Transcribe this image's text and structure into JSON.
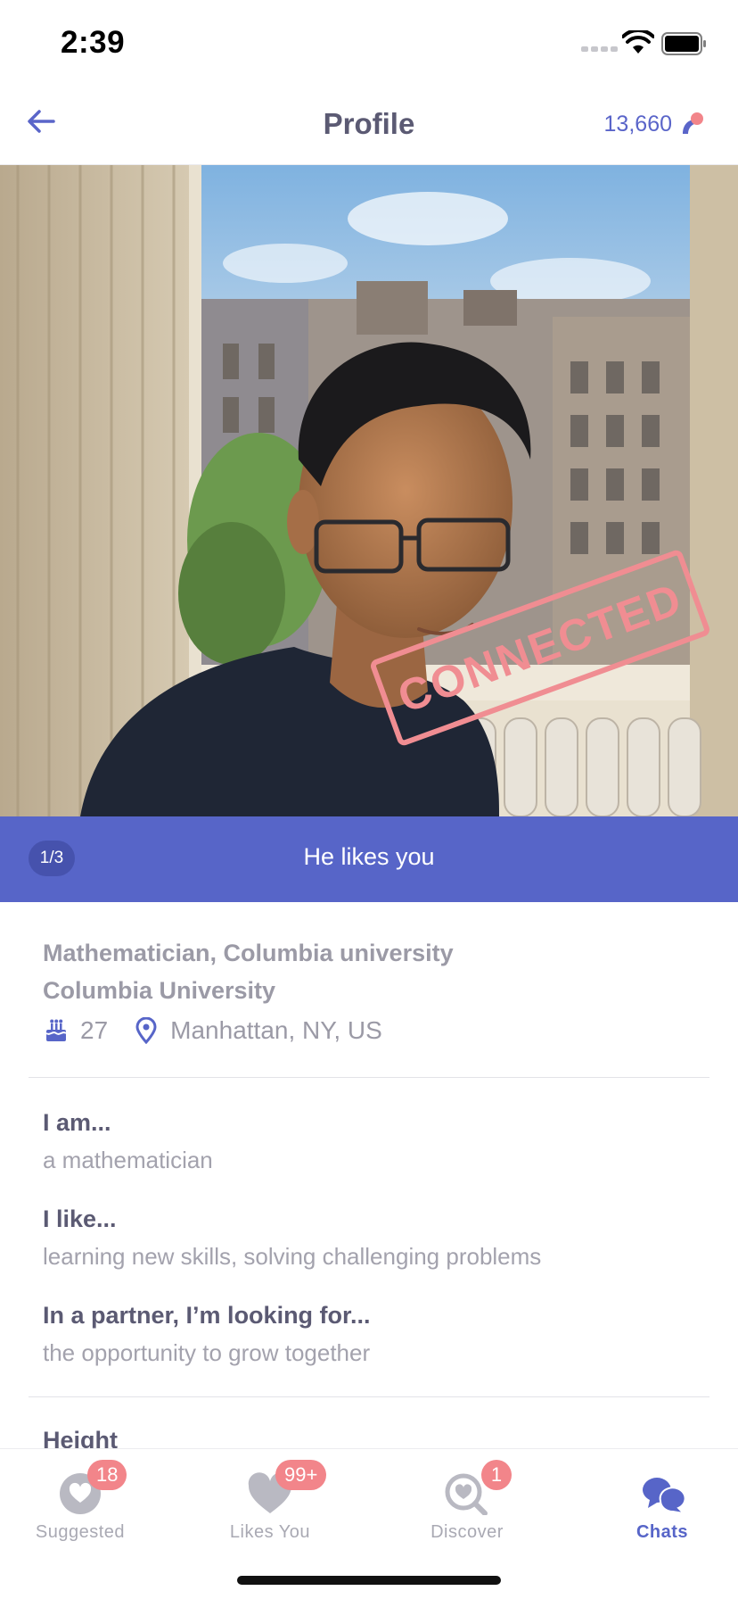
{
  "status_bar": {
    "time": "2:39"
  },
  "nav": {
    "title": "Profile",
    "coins": "13,660"
  },
  "photo": {
    "stamp_text": "CONNECTED"
  },
  "banner": {
    "page_indicator": "1/3",
    "likes_text": "He likes you"
  },
  "profile": {
    "job": "Mathematician, Columbia university",
    "school": "Columbia University",
    "age": "27",
    "location": "Manhattan, NY, US"
  },
  "prompts": [
    {
      "label": "I am...",
      "answer": "a mathematician"
    },
    {
      "label": "I like...",
      "answer": "learning new skills, solving challenging problems"
    },
    {
      "label": "In a partner, I’m looking for...",
      "answer": "the opportunity to grow together"
    }
  ],
  "next_section": "Height",
  "tabs": [
    {
      "label": "Suggested",
      "badge": "18",
      "icon": "heart-bubble-icon"
    },
    {
      "label": "Likes You",
      "badge": "99+",
      "icon": "heart-icon"
    },
    {
      "label": "Discover",
      "badge": "1",
      "icon": "magnify-heart-icon"
    },
    {
      "label": "Chats",
      "badge": "",
      "icon": "chat-bubbles-icon"
    }
  ],
  "colors": {
    "accent": "#5765c8",
    "badge": "#f2858a",
    "stamp": "#f08d92",
    "text_dark": "#5b5a73",
    "text_muted": "#a3a2ad"
  }
}
